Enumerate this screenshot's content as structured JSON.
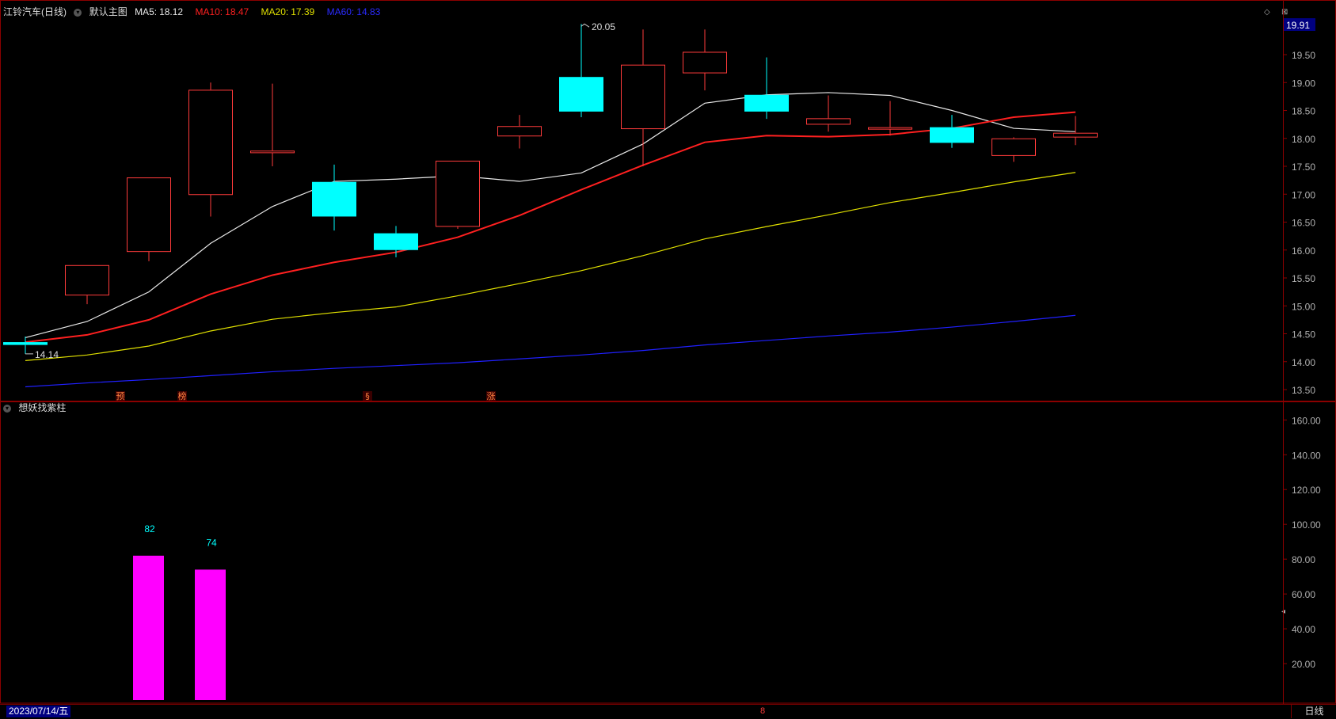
{
  "header": {
    "stock_name": "江铃汽车",
    "period_tag": "(日线)",
    "template_label": "默认主图",
    "ma5_label": "MA5:",
    "ma5_value": "18.12",
    "ma10_label": "MA10:",
    "ma10_value": "18.47",
    "ma20_label": "MA20:",
    "ma20_value": "17.39",
    "ma60_label": "MA60:",
    "ma60_value": "14.83"
  },
  "indicator_panel": {
    "title": "想妖找紫柱"
  },
  "footer": {
    "date_label": "2023/07/14/五",
    "period_button": "日线",
    "marker_label": "8"
  },
  "colors": {
    "up": "#ff3b3b",
    "down": "#00ffff",
    "ma5": "#e8e8e8",
    "ma10": "#ff2020",
    "ma20": "#e0e000",
    "ma60": "#2020ff",
    "bar": "#ff00ff",
    "axis": "#8b0000",
    "current_price_bg": "#000080"
  },
  "chart_data": [
    {
      "type": "candlestick",
      "title": "江铃汽车 (日线)",
      "ylim": [
        13.3,
        20.4
      ],
      "y_ticks": [
        "19.50",
        "19.00",
        "18.50",
        "18.00",
        "17.50",
        "17.00",
        "16.50",
        "16.00",
        "15.50",
        "15.00",
        "14.50",
        "14.00",
        "13.50"
      ],
      "current_price": "19.91",
      "high_label": "20.05",
      "low_label": "14.14",
      "candles": [
        {
          "open": 14.35,
          "close": 14.3,
          "high": 14.45,
          "low": 14.14
        },
        {
          "open": 15.2,
          "close": 15.73,
          "high": 15.73,
          "low": 15.03
        },
        {
          "open": 15.98,
          "close": 17.3,
          "high": 17.3,
          "low": 15.8
        },
        {
          "open": 17.0,
          "close": 18.87,
          "high": 19.0,
          "low": 16.6
        },
        {
          "open": 17.75,
          "close": 17.78,
          "high": 18.98,
          "low": 17.5
        },
        {
          "open": 17.22,
          "close": 16.6,
          "high": 17.53,
          "low": 16.35
        },
        {
          "open": 16.3,
          "close": 16.0,
          "high": 16.43,
          "low": 15.87
        },
        {
          "open": 16.43,
          "close": 17.6,
          "high": 17.6,
          "low": 16.38
        },
        {
          "open": 18.05,
          "close": 18.22,
          "high": 18.42,
          "low": 17.82
        },
        {
          "open": 19.1,
          "close": 18.48,
          "high": 20.05,
          "low": 18.38
        },
        {
          "open": 18.18,
          "close": 19.32,
          "high": 19.95,
          "low": 17.5
        },
        {
          "open": 19.18,
          "close": 19.55,
          "high": 19.95,
          "low": 18.86
        },
        {
          "open": 18.78,
          "close": 18.48,
          "high": 19.45,
          "low": 18.35
        },
        {
          "open": 18.26,
          "close": 18.36,
          "high": 18.77,
          "low": 18.12
        },
        {
          "open": 18.18,
          "close": 18.2,
          "high": 18.67,
          "low": 18.05
        },
        {
          "open": 18.2,
          "close": 17.92,
          "high": 18.42,
          "low": 17.83
        },
        {
          "open": 17.7,
          "close": 18.0,
          "high": 18.02,
          "low": 17.58
        },
        {
          "open": 18.03,
          "close": 18.1,
          "high": 18.4,
          "low": 17.88
        }
      ],
      "series": [
        {
          "name": "MA5",
          "values": [
            14.43,
            14.72,
            15.25,
            16.12,
            16.78,
            17.23,
            17.27,
            17.33,
            17.23,
            17.38,
            17.9,
            18.63,
            18.78,
            18.82,
            18.77,
            18.5,
            18.18,
            18.12
          ]
        },
        {
          "name": "MA10",
          "values": [
            14.35,
            14.48,
            14.75,
            15.21,
            15.55,
            15.78,
            15.96,
            16.23,
            16.62,
            17.08,
            17.52,
            17.93,
            18.05,
            18.03,
            18.07,
            18.18,
            18.38,
            18.47
          ]
        },
        {
          "name": "MA20",
          "values": [
            14.02,
            14.12,
            14.28,
            14.55,
            14.76,
            14.88,
            14.98,
            15.18,
            15.4,
            15.63,
            15.9,
            16.2,
            16.42,
            16.63,
            16.85,
            17.03,
            17.22,
            17.39
          ]
        },
        {
          "name": "MA60",
          "values": [
            13.55,
            13.62,
            13.68,
            13.75,
            13.82,
            13.88,
            13.93,
            13.98,
            14.05,
            14.12,
            14.2,
            14.3,
            14.38,
            14.46,
            14.53,
            14.62,
            14.72,
            14.83
          ]
        }
      ],
      "signal_labels": [
        {
          "index": 1,
          "text": "预"
        },
        {
          "index": 2,
          "text": "榜"
        },
        {
          "index": 5,
          "text": "§"
        },
        {
          "index": 7,
          "text": "涨"
        }
      ]
    },
    {
      "type": "bar",
      "title": "想妖找紫柱",
      "ylim": [
        0,
        170
      ],
      "y_ticks": [
        "160.00",
        "140.00",
        "120.00",
        "100.00",
        "80.00",
        "60.00",
        "40.00",
        "20.00"
      ],
      "bars": [
        {
          "index": 2,
          "value": 82
        },
        {
          "index": 3,
          "value": 74
        }
      ]
    }
  ]
}
